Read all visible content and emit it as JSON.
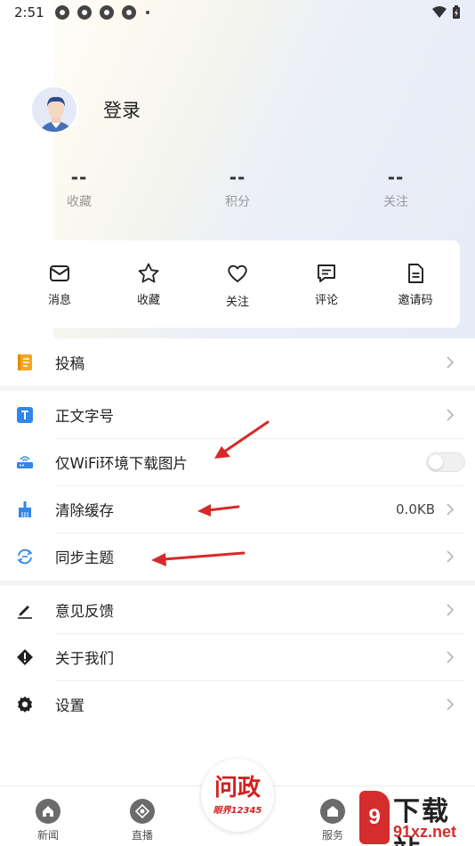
{
  "status_bar": {
    "time": "2:51"
  },
  "profile": {
    "login_label": "登录"
  },
  "stats": [
    {
      "value": "--",
      "label": "收藏"
    },
    {
      "value": "--",
      "label": "积分"
    },
    {
      "value": "--",
      "label": "关注"
    }
  ],
  "quick_actions": [
    {
      "label": "消息",
      "icon": "mail-icon"
    },
    {
      "label": "收藏",
      "icon": "star-icon"
    },
    {
      "label": "关注",
      "icon": "heart-icon"
    },
    {
      "label": "评论",
      "icon": "comment-icon"
    },
    {
      "label": "邀请码",
      "icon": "document-icon"
    }
  ],
  "menu": {
    "contribute": {
      "label": "投稿",
      "icon": "notebook-icon"
    },
    "font_size": {
      "label": "正文字号",
      "icon": "text-size-icon"
    },
    "wifi_images": {
      "label": "仅WiFi环境下载图片",
      "icon": "wifi-router-icon",
      "enabled": false
    },
    "clear_cache": {
      "label": "清除缓存",
      "value": "0.0KB",
      "icon": "broom-icon"
    },
    "sync_theme": {
      "label": "同步主题",
      "icon": "sync-icon"
    },
    "feedback": {
      "label": "意见反馈",
      "icon": "pencil-icon"
    },
    "about": {
      "label": "关于我们",
      "icon": "info-diamond-icon"
    },
    "settings": {
      "label": "设置",
      "icon": "gear-icon"
    }
  },
  "bottom_nav": {
    "news": {
      "label": "新闻",
      "icon": "home-icon"
    },
    "live": {
      "label": "直播",
      "icon": "live-icon"
    },
    "center": {
      "title": "问政",
      "subtitle": "眼界12345"
    },
    "service": {
      "label": "服务",
      "icon": "service-icon"
    }
  },
  "watermark": {
    "logo": "9",
    "title": "下载站",
    "url": "91xz.net"
  },
  "colors": {
    "accent_orange": "#f5a623",
    "accent_blue": "#2f86eb",
    "arrow_red": "#d62a2a",
    "brand_red": "#d42020"
  }
}
